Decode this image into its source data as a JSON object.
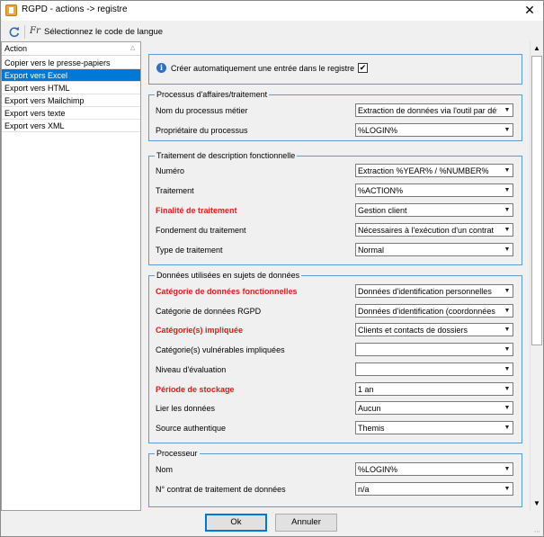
{
  "window": {
    "title": "RGPD - actions -> registre",
    "close_glyph": "✕"
  },
  "toolbar": {
    "refresh_icon": "refresh-icon",
    "lang_abbr": "Fr",
    "lang_label": "Sélectionnez le code de langue"
  },
  "left_panel": {
    "header": "Action",
    "items": [
      {
        "label": "Copier vers le presse-papiers",
        "selected": false
      },
      {
        "label": "Export vers Excel",
        "selected": true
      },
      {
        "label": "Export vers HTML",
        "selected": false
      },
      {
        "label": "Export vers Mailchimp",
        "selected": false
      },
      {
        "label": "Export vers texte",
        "selected": false
      },
      {
        "label": "Export vers XML",
        "selected": false
      }
    ]
  },
  "auto_create": {
    "label": "Créer automatiquement une entrée dans le registre",
    "checked": true,
    "check_glyph": "✔"
  },
  "groups": {
    "processus": {
      "title": "Processus d'affaires/traitement",
      "rows": [
        {
          "label": "Nom du processus métier",
          "value": "Extraction de données via l'outil par défau",
          "required": false
        },
        {
          "label": "Propriétaire du processus",
          "value": "%LOGIN%",
          "required": false
        }
      ]
    },
    "traitement": {
      "title": "Traitement de description fonctionnelle",
      "rows": [
        {
          "label": "Numéro",
          "value": "Extraction %YEAR% / %NUMBER%",
          "required": false
        },
        {
          "label": "Traitement",
          "value": "%ACTION%",
          "required": false
        },
        {
          "label": "Finalité de traitement",
          "value": "Gestion client",
          "required": true
        },
        {
          "label": "Fondement du traitement",
          "value": "Nécessaires à l'exécution d'un contrat",
          "required": false
        },
        {
          "label": "Type de traitement",
          "value": "Normal",
          "required": false
        }
      ]
    },
    "donnees": {
      "title": "Données utilisées en sujets de données",
      "rows": [
        {
          "label": "Catégorie de données fonctionnelles",
          "value": "Données d'identification personnelles",
          "required": true
        },
        {
          "label": "Catégorie de données RGPD",
          "value": "Données d'identification (coordonnées et",
          "required": false
        },
        {
          "label": "Catégorie(s) impliquée",
          "value": "Clients et contacts de dossiers",
          "required": true
        },
        {
          "label": "Catégorie(s) vulnérables impliquées",
          "value": "",
          "required": false
        },
        {
          "label": "Niveau d'évaluation",
          "value": "",
          "required": false
        },
        {
          "label": "Période de stockage",
          "value": "1 an",
          "required": true
        },
        {
          "label": "Lier les données",
          "value": "Aucun",
          "required": false
        },
        {
          "label": "Source authentique",
          "value": "Themis",
          "required": false
        }
      ]
    },
    "processeur": {
      "title": "Processeur",
      "rows": [
        {
          "label": "Nom",
          "value": "%LOGIN%",
          "required": false
        },
        {
          "label": "N° contrat de traitement de données",
          "value": "n/a",
          "required": false
        }
      ]
    }
  },
  "buttons": {
    "ok": "Ok",
    "cancel": "Annuler"
  },
  "colors": {
    "accent": "#0078d7",
    "required": "#e21b1b",
    "group_border": "#5b9bd5"
  }
}
